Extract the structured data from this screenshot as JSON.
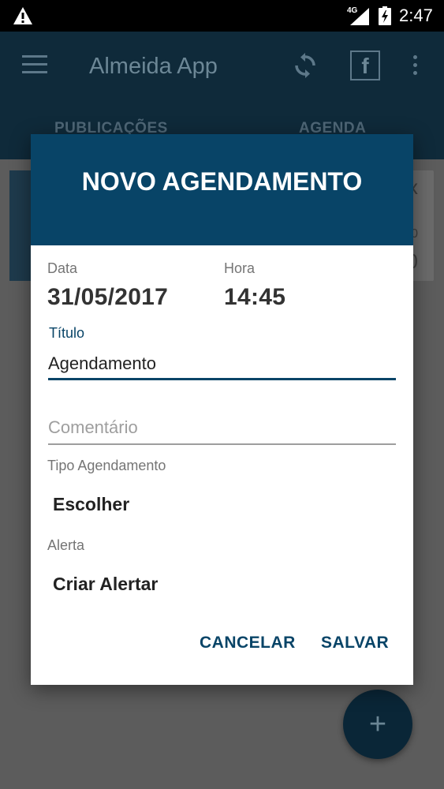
{
  "status_bar": {
    "network": "4G",
    "time": "2:47"
  },
  "app_bar": {
    "title": "Almeida App",
    "facebook_glyph": "f",
    "tabs": [
      {
        "label": "PUBLICAÇÕES"
      },
      {
        "label": "AGENDA"
      }
    ]
  },
  "background_card": {
    "close_glyph": "x",
    "partial_text_1": "0",
    "partial_text_2": "0"
  },
  "fab": {
    "glyph": "+"
  },
  "dialog": {
    "title": "NOVO AGENDAMENTO",
    "date_label": "Data",
    "date_value": "31/05/2017",
    "time_label": "Hora",
    "time_value": "14:45",
    "title_label": "Título",
    "title_value": "Agendamento",
    "comment_placeholder": "Comentário",
    "type_label": "Tipo Agendamento",
    "type_value": "Escolher",
    "alert_label": "Alerta",
    "alert_value": "Criar Alertar",
    "cancel_label": "CANCELAR",
    "save_label": "SALVAR"
  },
  "colors": {
    "primary": "#084467",
    "header_dimmed": "#0f2a3a",
    "status_bar": "#000000"
  },
  "icons": [
    "warning-icon",
    "signal-icon",
    "battery-charging-icon",
    "menu-icon",
    "sync-icon",
    "facebook-icon",
    "overflow-menu-icon",
    "add-icon"
  ]
}
